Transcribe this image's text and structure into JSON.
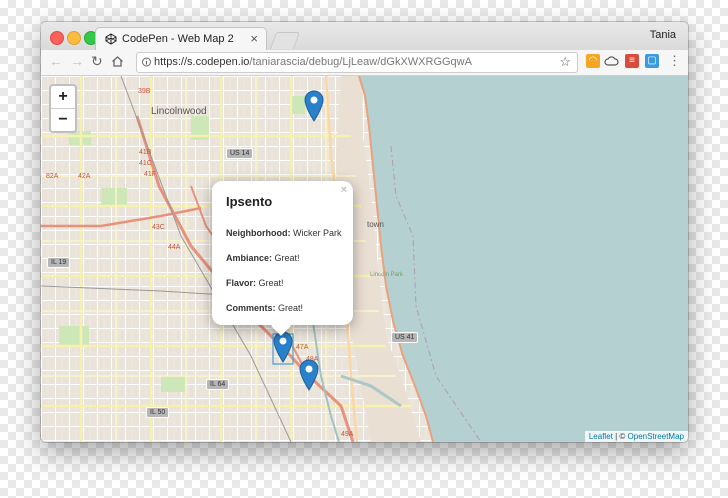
{
  "window": {
    "tab_title": "CodePen - Web Map 2",
    "tab_close": "×",
    "user_name": "Tania",
    "url_host": "https://s.codepen.io",
    "url_path": "/taniarascia/debug/LjLeaw/dGkXWXRGGqwA"
  },
  "map": {
    "zoom_in": "+",
    "zoom_out": "−",
    "labels": {
      "lincolnwood": "Lincolnwood",
      "lincoln_park": "Lincoln Park",
      "town": "town"
    },
    "shields": {
      "us14": "US 14",
      "us41": "US 41",
      "il19": "IL 19",
      "il64": "IL 64",
      "il50": "IL 50",
      "x39b": "39B",
      "x41b": "41B",
      "x41c": "41C",
      "x41f": "41F",
      "x42a": "42A",
      "x43c": "43C",
      "x44a": "44A",
      "x47a": "47A",
      "x48a": "48A",
      "x49a": "49A",
      "x82a": "82A"
    },
    "attribution_leaflet": "Leaflet",
    "attribution_sep": " | © ",
    "attribution_osm": "OpenStreetMap",
    "popup": {
      "title": "Ipsento",
      "close": "×",
      "neighborhood_label": "Neighborhood:",
      "neighborhood_value": "Wicker Park",
      "ambiance_label": "Ambiance:",
      "ambiance_value": "Great!",
      "flavor_label": "Flavor:",
      "flavor_value": "Great!",
      "comments_label": "Comments:",
      "comments_value": "Great!"
    },
    "colors": {
      "water": "#b5d0d0",
      "land": "#ebe5dd",
      "marker": "#2a81cb",
      "park": "#cde7b8"
    }
  }
}
